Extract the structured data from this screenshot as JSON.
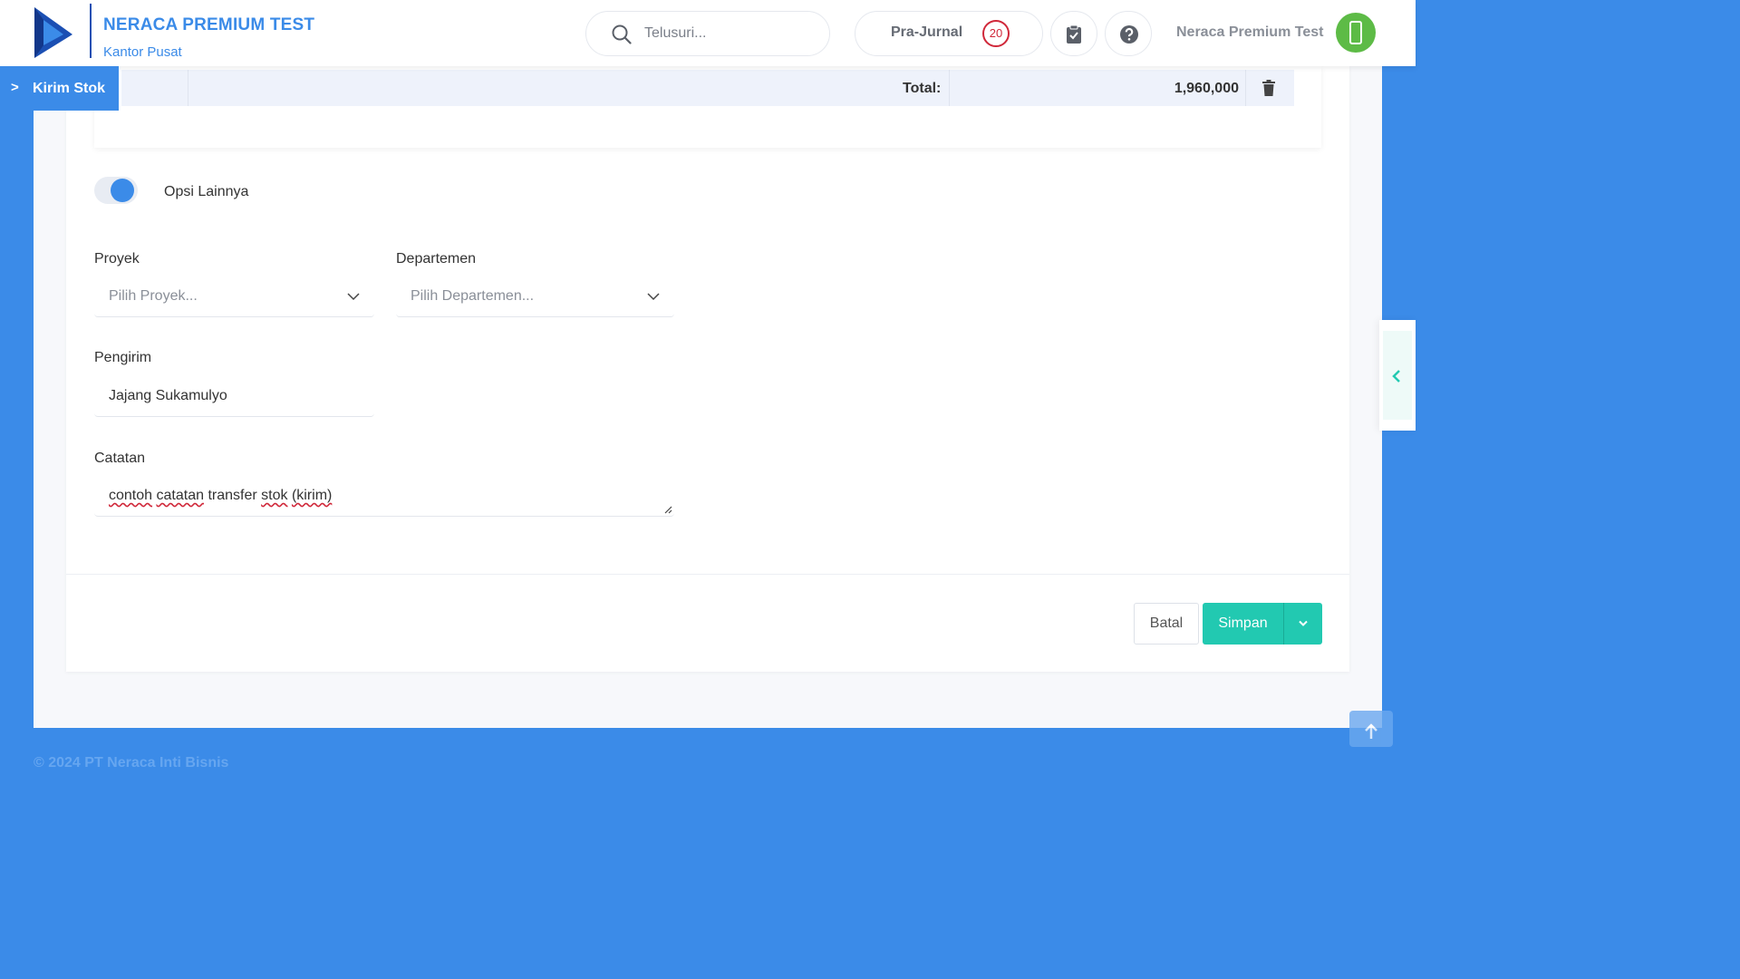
{
  "header": {
    "company_name": "NERACA PREMIUM TEST",
    "branch": "Kantor Pusat",
    "search_placeholder": "Telusuri...",
    "prajurnal_label": "Pra-Jurnal",
    "prajurnal_count": "20",
    "user_name": "Neraca Premium Test",
    "brand_color": "#3b8be8"
  },
  "breadcrumb": {
    "current": "Kirim Stok"
  },
  "table": {
    "total_label": "Total:",
    "total_value": "1,960,000"
  },
  "options": {
    "toggle_label": "Opsi Lainnya",
    "toggle_on": true
  },
  "form": {
    "proyek": {
      "label": "Proyek",
      "placeholder": "Pilih Proyek..."
    },
    "departemen": {
      "label": "Departemen",
      "placeholder": "Pilih Departemen..."
    },
    "pengirim": {
      "label": "Pengirim",
      "value": "Jajang Sukamulyo"
    },
    "catatan": {
      "label": "Catatan",
      "words": [
        "contoh",
        "catatan",
        "transfer",
        "stok",
        "(kirim)"
      ]
    }
  },
  "actions": {
    "cancel_label": "Batal",
    "save_label": "Simpan",
    "accent_color": "#22c9b1"
  },
  "footer": {
    "copyright": "© 2024 PT Neraca Inti Bisnis"
  }
}
